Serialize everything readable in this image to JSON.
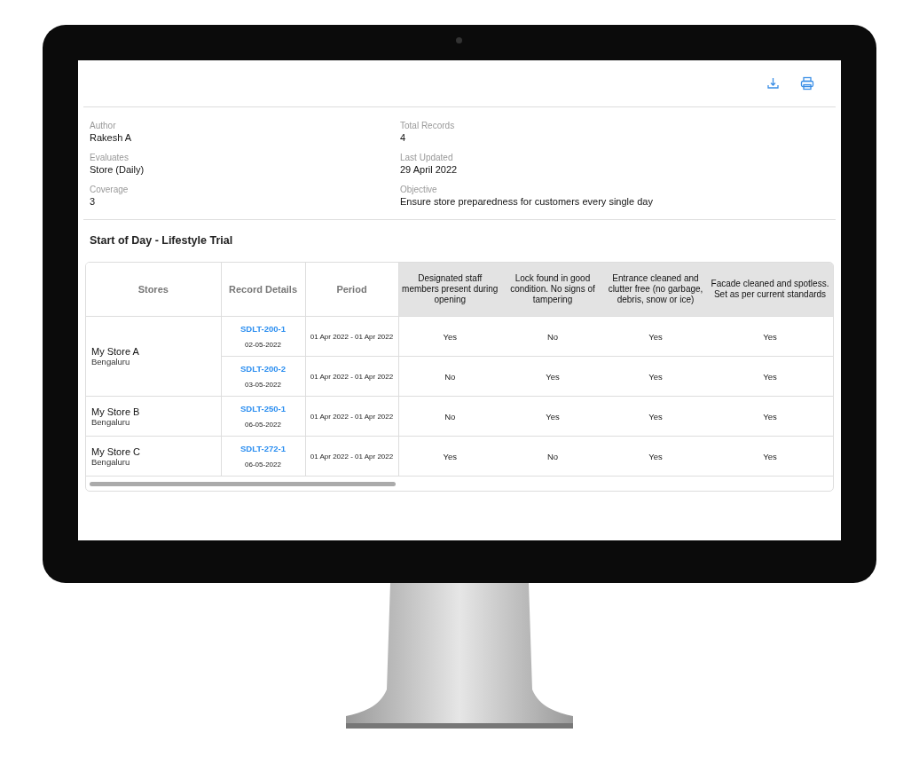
{
  "toolbar": {
    "actions": [
      {
        "kind": "export"
      },
      {
        "kind": "print"
      }
    ]
  },
  "meta": {
    "left": [
      {
        "label": "Author",
        "value": "Rakesh A"
      },
      {
        "label": "Evaluates",
        "value": "Store (Daily)"
      },
      {
        "label": "Coverage",
        "value": "3"
      }
    ],
    "right": [
      {
        "label": "Total Records",
        "value": "4"
      },
      {
        "label": "Last Updated",
        "value": "29 April 2022"
      },
      {
        "label": "Objective",
        "value": "Ensure store preparedness for customers every single day"
      }
    ]
  },
  "section_title": "Start of Day - Lifestyle Trial",
  "table": {
    "columns": [
      "Stores",
      "Record Details",
      "Period"
    ],
    "question_columns": [
      "Designated staff members present during opening",
      "Lock found in good condition. No signs of tampering",
      "Entrance cleaned and clutter free (no garbage, debris, snow or ice)",
      "Facade cleaned and spotless. Set as per current standards"
    ],
    "stores": [
      {
        "name": "My Store A",
        "city": "Bengaluru",
        "records": [
          {
            "id": "SDLT-200-1",
            "date": "02-05-2022",
            "period": "01 Apr 2022 - 01 Apr 2022",
            "answers": [
              "Yes",
              "No",
              "Yes",
              "Yes"
            ]
          },
          {
            "id": "SDLT-200-2",
            "date": "03-05-2022",
            "period": "01 Apr 2022 - 01 Apr 2022",
            "answers": [
              "No",
              "Yes",
              "Yes",
              "Yes"
            ]
          }
        ]
      },
      {
        "name": "My Store B",
        "city": "Bengaluru",
        "records": [
          {
            "id": "SDLT-250-1",
            "date": "06-05-2022",
            "period": "01 Apr 2022 - 01 Apr 2022",
            "answers": [
              "No",
              "Yes",
              "Yes",
              "Yes"
            ]
          }
        ]
      },
      {
        "name": "My Store C",
        "city": "Bengaluru",
        "records": [
          {
            "id": "SDLT-272-1",
            "date": "06-05-2022",
            "period": "01 Apr 2022 - 01 Apr 2022",
            "answers": [
              "Yes",
              "No",
              "Yes",
              "Yes"
            ]
          }
        ]
      }
    ]
  }
}
